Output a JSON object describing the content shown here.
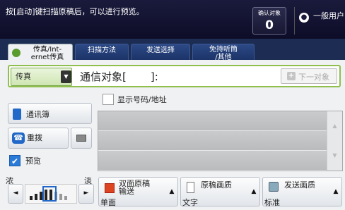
{
  "status": {
    "message": "按[启动]键扫描原稿后，可以进行预览。",
    "confirm_label": "确认对象",
    "confirm_count": "0",
    "user_label": "一般用户"
  },
  "tabs": [
    {
      "label": "传真/Int-\nernet传真"
    },
    {
      "label": "扫描方法"
    },
    {
      "label": "发送选择"
    },
    {
      "label": "免持听筒\n/其他"
    }
  ],
  "address": {
    "type_value": "传真",
    "recipient_label": "通信对象[",
    "recipient_value": "",
    "recipient_suffix": "]:",
    "next_label": "下一对象"
  },
  "options": {
    "show_number_label": "显示号码/地址",
    "address_book": "通讯簿",
    "redial": "重拨",
    "preview": "预览"
  },
  "darkness": {
    "dark_label": "浓",
    "light_label": "淡",
    "level_fraction": 0.5
  },
  "features": {
    "duplex_title": "双面原稿\n输送",
    "duplex_value": "单面",
    "quality_title": "原稿画质",
    "quality_value": "文字",
    "resolution_title": "发送画质",
    "resolution_value": "标准"
  },
  "colors": {
    "accent": "#8fbf4f",
    "topbar": "#1a1a3c",
    "icon_blue": "#2268c8"
  }
}
